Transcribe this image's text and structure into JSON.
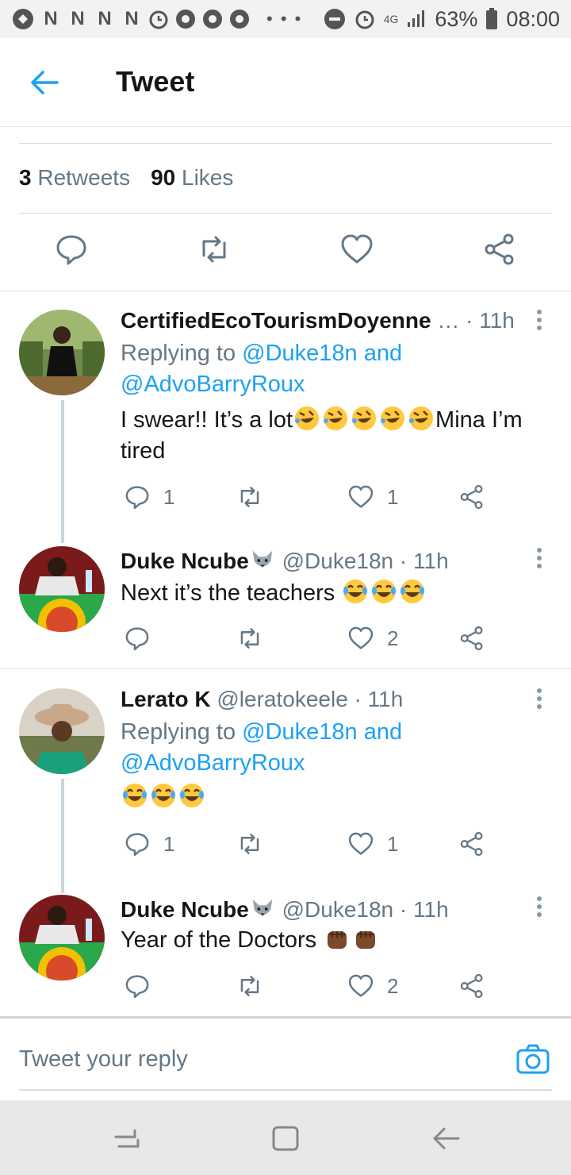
{
  "status_bar": {
    "left_glyphs": [
      "N",
      "N",
      "N",
      "N"
    ],
    "dots": "• • •",
    "network": "4G",
    "battery": "63%",
    "time": "08:00"
  },
  "header": {
    "title": "Tweet"
  },
  "stats": {
    "retweets_count": "3",
    "retweets_label": "Retweets",
    "likes_count": "90",
    "likes_label": "Likes"
  },
  "replies": [
    {
      "name": "CertifiedEcoTourismDoyenne",
      "ellipsis": "…",
      "time": "· 11h",
      "replying_prefix": "Replying to ",
      "mention_1": "@Duke18n and",
      "mention_2": "@AdvoBarryRoux",
      "text_before": "I swear!! It’s a lot",
      "text_after": "Mina I’m tired",
      "reply_count": "1",
      "like_count": "1"
    },
    {
      "name": "Duke Ncube",
      "handle": "@Duke18n",
      "time": "· 11h",
      "text": "Next it’s the teachers",
      "like_count": "2"
    },
    {
      "name": "Lerato K",
      "handle": "@leratokeele",
      "time": "· 11h",
      "replying_prefix": "Replying to ",
      "mention_1": "@Duke18n and",
      "mention_2": "@AdvoBarryRoux",
      "reply_count": "1",
      "like_count": "1"
    },
    {
      "name": "Duke Ncube",
      "handle": "@Duke18n",
      "time": "· 11h",
      "text": "Year of the Doctors",
      "like_count": "2"
    }
  ],
  "compose": {
    "placeholder": "Tweet your reply"
  },
  "colors": {
    "accent": "#1da1f2",
    "secondary_text": "#657786",
    "primary_text": "#14171a"
  },
  "icons": {
    "back": "back-arrow-icon",
    "reply": "reply-bubble-icon",
    "retweet": "retweet-icon",
    "like": "heart-icon",
    "share": "share-icon",
    "more": "more-vertical-icon",
    "camera": "camera-icon"
  }
}
